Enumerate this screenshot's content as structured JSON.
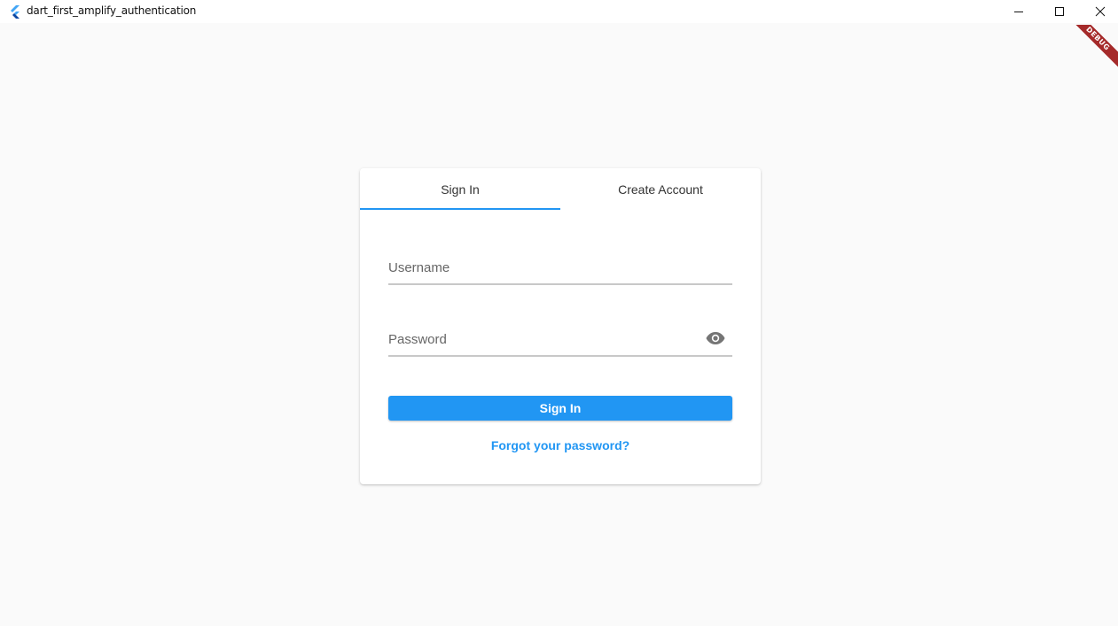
{
  "window": {
    "title": "dart_first_amplify_authentication",
    "icon": "flutter-logo-icon",
    "controls": [
      "minimize-icon",
      "maximize-icon",
      "close-icon"
    ]
  },
  "debug_banner": {
    "label": "DEBUG",
    "color": "#a52a2a"
  },
  "auth": {
    "tabs": [
      {
        "label": "Sign In",
        "selected": true
      },
      {
        "label": "Create Account",
        "selected": false
      }
    ],
    "username": {
      "label": "Username",
      "value": ""
    },
    "password": {
      "label": "Password",
      "value": "",
      "toggle_icon": "eye-icon"
    },
    "sign_in_label": "Sign In",
    "forgot_label": "Forgot your password?"
  },
  "colors": {
    "accent": "#2196f3",
    "background": "#fafafa",
    "card": "#ffffff"
  }
}
